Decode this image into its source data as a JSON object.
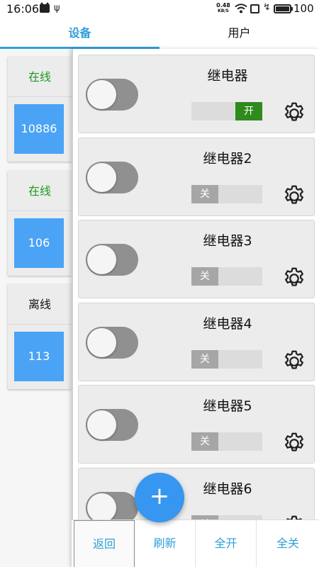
{
  "status_bar": {
    "time": "16:06",
    "net_speed_value": "0.48",
    "net_speed_unit": "KB/S",
    "battery_level": "100",
    "icons": [
      "notification-cat-icon",
      "usb-icon",
      "wifi-icon",
      "sim-icon",
      "charging-bolt-icon",
      "battery-icon"
    ]
  },
  "tabs": [
    {
      "label": "设备",
      "active": true
    },
    {
      "label": "用户",
      "active": false
    }
  ],
  "devices": [
    {
      "status": "在线",
      "id": "10886",
      "online": true
    },
    {
      "status": "在线",
      "id": "106",
      "online": true
    },
    {
      "status": "离线",
      "id": "113",
      "online": false
    }
  ],
  "relays": [
    {
      "name": "继电器",
      "state": "开",
      "on": true
    },
    {
      "name": "继电器2",
      "state": "关",
      "on": false
    },
    {
      "name": "继电器3",
      "state": "关",
      "on": false
    },
    {
      "name": "继电器4",
      "state": "关",
      "on": false
    },
    {
      "name": "继电器5",
      "state": "关",
      "on": false
    },
    {
      "name": "继电器6",
      "state": "关",
      "on": false
    }
  ],
  "fab": {
    "label": "+"
  },
  "bottom_bar": {
    "back": "返回",
    "refresh": "刷新",
    "all_on": "全开",
    "all_off": "全关"
  },
  "colors": {
    "accent": "#2f9fd8",
    "online_text": "#1e9a1e",
    "offline_text": "#111111",
    "device_tile": "#4aa3f5",
    "state_on": "#2e8b1c",
    "state_off": "#a6a6a6",
    "fab": "#3796f0"
  }
}
